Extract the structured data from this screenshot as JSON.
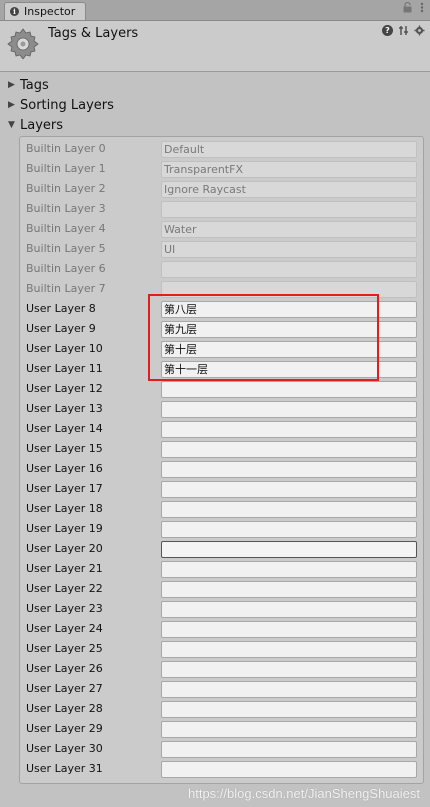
{
  "tab": {
    "label": "Inspector"
  },
  "header": {
    "title": "Tags & Layers"
  },
  "foldouts": [
    {
      "label": "Tags",
      "expanded": false
    },
    {
      "label": "Sorting Layers",
      "expanded": false
    },
    {
      "label": "Layers",
      "expanded": true
    }
  ],
  "layers": [
    {
      "label": "Builtin Layer 0",
      "value": "Default",
      "builtin": true
    },
    {
      "label": "Builtin Layer 1",
      "value": "TransparentFX",
      "builtin": true
    },
    {
      "label": "Builtin Layer 2",
      "value": "Ignore Raycast",
      "builtin": true
    },
    {
      "label": "Builtin Layer 3",
      "value": "",
      "builtin": true
    },
    {
      "label": "Builtin Layer 4",
      "value": "Water",
      "builtin": true
    },
    {
      "label": "Builtin Layer 5",
      "value": "UI",
      "builtin": true
    },
    {
      "label": "Builtin Layer 6",
      "value": "",
      "builtin": true
    },
    {
      "label": "Builtin Layer 7",
      "value": "",
      "builtin": true
    },
    {
      "label": "User Layer 8",
      "value": "第八层",
      "builtin": false
    },
    {
      "label": "User Layer 9",
      "value": "第九层",
      "builtin": false
    },
    {
      "label": "User Layer 10",
      "value": "第十层",
      "builtin": false
    },
    {
      "label": "User Layer 11",
      "value": "第十一层",
      "builtin": false
    },
    {
      "label": "User Layer 12",
      "value": "",
      "builtin": false
    },
    {
      "label": "User Layer 13",
      "value": "",
      "builtin": false
    },
    {
      "label": "User Layer 14",
      "value": "",
      "builtin": false
    },
    {
      "label": "User Layer 15",
      "value": "",
      "builtin": false
    },
    {
      "label": "User Layer 16",
      "value": "",
      "builtin": false
    },
    {
      "label": "User Layer 17",
      "value": "",
      "builtin": false
    },
    {
      "label": "User Layer 18",
      "value": "",
      "builtin": false
    },
    {
      "label": "User Layer 19",
      "value": "",
      "builtin": false
    },
    {
      "label": "User Layer 20",
      "value": "",
      "builtin": false,
      "focused": true
    },
    {
      "label": "User Layer 21",
      "value": "",
      "builtin": false
    },
    {
      "label": "User Layer 22",
      "value": "",
      "builtin": false
    },
    {
      "label": "User Layer 23",
      "value": "",
      "builtin": false
    },
    {
      "label": "User Layer 24",
      "value": "",
      "builtin": false
    },
    {
      "label": "User Layer 25",
      "value": "",
      "builtin": false
    },
    {
      "label": "User Layer 26",
      "value": "",
      "builtin": false
    },
    {
      "label": "User Layer 27",
      "value": "",
      "builtin": false
    },
    {
      "label": "User Layer 28",
      "value": "",
      "builtin": false
    },
    {
      "label": "User Layer 29",
      "value": "",
      "builtin": false
    },
    {
      "label": "User Layer 30",
      "value": "",
      "builtin": false
    },
    {
      "label": "User Layer 31",
      "value": "",
      "builtin": false
    }
  ],
  "highlight_color": "#e21d1d",
  "watermark": "https://blog.csdn.net/JianShengShuaiest"
}
